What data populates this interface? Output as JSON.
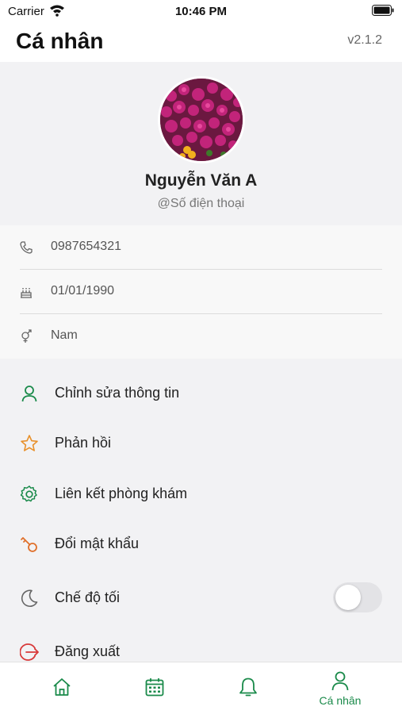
{
  "status_bar": {
    "carrier": "Carrier",
    "time": "10:46 PM"
  },
  "header": {
    "title": "Cá nhân",
    "version": "v2.1.2"
  },
  "profile": {
    "name": "Nguyễn Văn A",
    "handle": "@Số điện thoại"
  },
  "info": {
    "phone": {
      "icon": "phone-icon",
      "value": "0987654321"
    },
    "birthday": {
      "icon": "birthday-cake-icon",
      "value": "01/01/1990"
    },
    "gender": {
      "icon": "gender-icon",
      "value": "Nam"
    }
  },
  "menu": {
    "items": [
      {
        "label": "Chỉnh sửa thông tin",
        "icon": "user-edit-icon",
        "color": "#1a8a4a"
      },
      {
        "label": "Phản hồi",
        "icon": "star-icon",
        "color": "#e8902a"
      },
      {
        "label": "Liên kết phòng khám",
        "icon": "gear-icon",
        "color": "#1a8a4a"
      },
      {
        "label": "Đổi mật khẩu",
        "icon": "key-icon",
        "color": "#e0702a"
      },
      {
        "label": "Chế độ tối",
        "icon": "moon-icon",
        "color": "#666666"
      },
      {
        "label": "Đăng xuất",
        "icon": "logout-icon",
        "color": "#d83a3a"
      }
    ],
    "dark_mode_enabled": false
  },
  "tabbar": {
    "accent": "#1a8a4a",
    "tabs": [
      {
        "icon": "home-icon",
        "label": ""
      },
      {
        "icon": "calendar-icon",
        "label": ""
      },
      {
        "icon": "bell-icon",
        "label": ""
      },
      {
        "icon": "profile-icon",
        "label": "Cá nhân",
        "active": true
      }
    ]
  }
}
